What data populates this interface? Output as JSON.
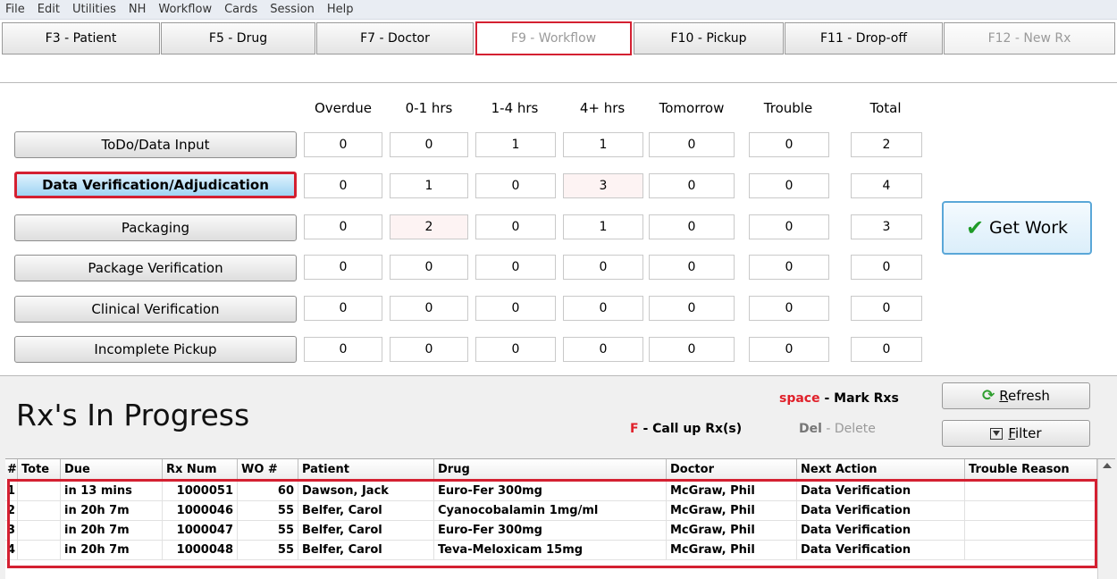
{
  "menu": [
    "File",
    "Edit",
    "Utilities",
    "NH",
    "Workflow",
    "Cards",
    "Session",
    "Help"
  ],
  "fkeys": [
    {
      "label": "F3 - Patient",
      "state": "normal"
    },
    {
      "label": "F5 - Drug",
      "state": "normal"
    },
    {
      "label": "F7 - Doctor",
      "state": "normal"
    },
    {
      "label": "F9 - Workflow",
      "state": "active"
    },
    {
      "label": "F10 - Pickup",
      "state": "normal"
    },
    {
      "label": "F11 - Drop-off",
      "state": "normal"
    },
    {
      "label": "F12 - New Rx",
      "state": "disabled"
    }
  ],
  "workflow": {
    "columns": [
      "Overdue",
      "0-1 hrs",
      "1-4 hrs",
      "4+ hrs",
      "Tomorrow",
      "Trouble",
      "Total"
    ],
    "rows": [
      {
        "label": "ToDo/Data Input",
        "values": [
          "0",
          "0",
          "1",
          "1",
          "0",
          "0",
          "2"
        ]
      },
      {
        "label": "Data Verification/Adjudication",
        "values": [
          "0",
          "1",
          "0",
          "3",
          "0",
          "0",
          "4"
        ]
      },
      {
        "label": "Packaging",
        "values": [
          "0",
          "2",
          "0",
          "1",
          "0",
          "0",
          "3"
        ]
      },
      {
        "label": "Package Verification",
        "values": [
          "0",
          "0",
          "0",
          "0",
          "0",
          "0",
          "0"
        ]
      },
      {
        "label": "Clinical Verification",
        "values": [
          "0",
          "0",
          "0",
          "0",
          "0",
          "0",
          "0"
        ]
      },
      {
        "label": "Incomplete Pickup",
        "values": [
          "0",
          "0",
          "0",
          "0",
          "0",
          "0",
          "0"
        ]
      }
    ],
    "selected_row": "Data Verification/Adjudication",
    "get_work_label": "Get Work"
  },
  "in_progress": {
    "title": "Rx's In Progress",
    "hint_space_key": "space",
    "hint_space_text": " - Mark Rxs",
    "hint_f_key": "F",
    "hint_f_text": " - Call up Rx(s)",
    "hint_del_key": "Del",
    "hint_del_text": " - Delete",
    "refresh_letter": "R",
    "refresh_rest": "efresh",
    "filter_letter": "F",
    "filter_rest": "ilter",
    "columns": [
      "#",
      "Tote",
      "Due",
      "Rx Num",
      "WO #",
      "Patient",
      "Drug",
      "Doctor",
      "Next Action",
      "Trouble Reason"
    ],
    "rows": [
      [
        "1",
        "",
        "in 13 mins",
        "1000051",
        "60",
        "Dawson, Jack",
        "Euro-Fer 300mg",
        "McGraw, Phil",
        "Data Verification",
        ""
      ],
      [
        "2",
        "",
        "in 20h 7m",
        "1000046",
        "55",
        "Belfer, Carol",
        "Cyanocobalamin 1mg/ml",
        "McGraw, Phil",
        "Data Verification",
        ""
      ],
      [
        "3",
        "",
        "in 20h 7m",
        "1000047",
        "55",
        "Belfer, Carol",
        "Euro-Fer 300mg",
        "McGraw, Phil",
        "Data Verification",
        ""
      ],
      [
        "4",
        "",
        "in 20h 7m",
        "1000048",
        "55",
        "Belfer, Carol",
        "Teva-Meloxicam 15mg",
        "McGraw, Phil",
        "Data Verification",
        ""
      ]
    ]
  }
}
